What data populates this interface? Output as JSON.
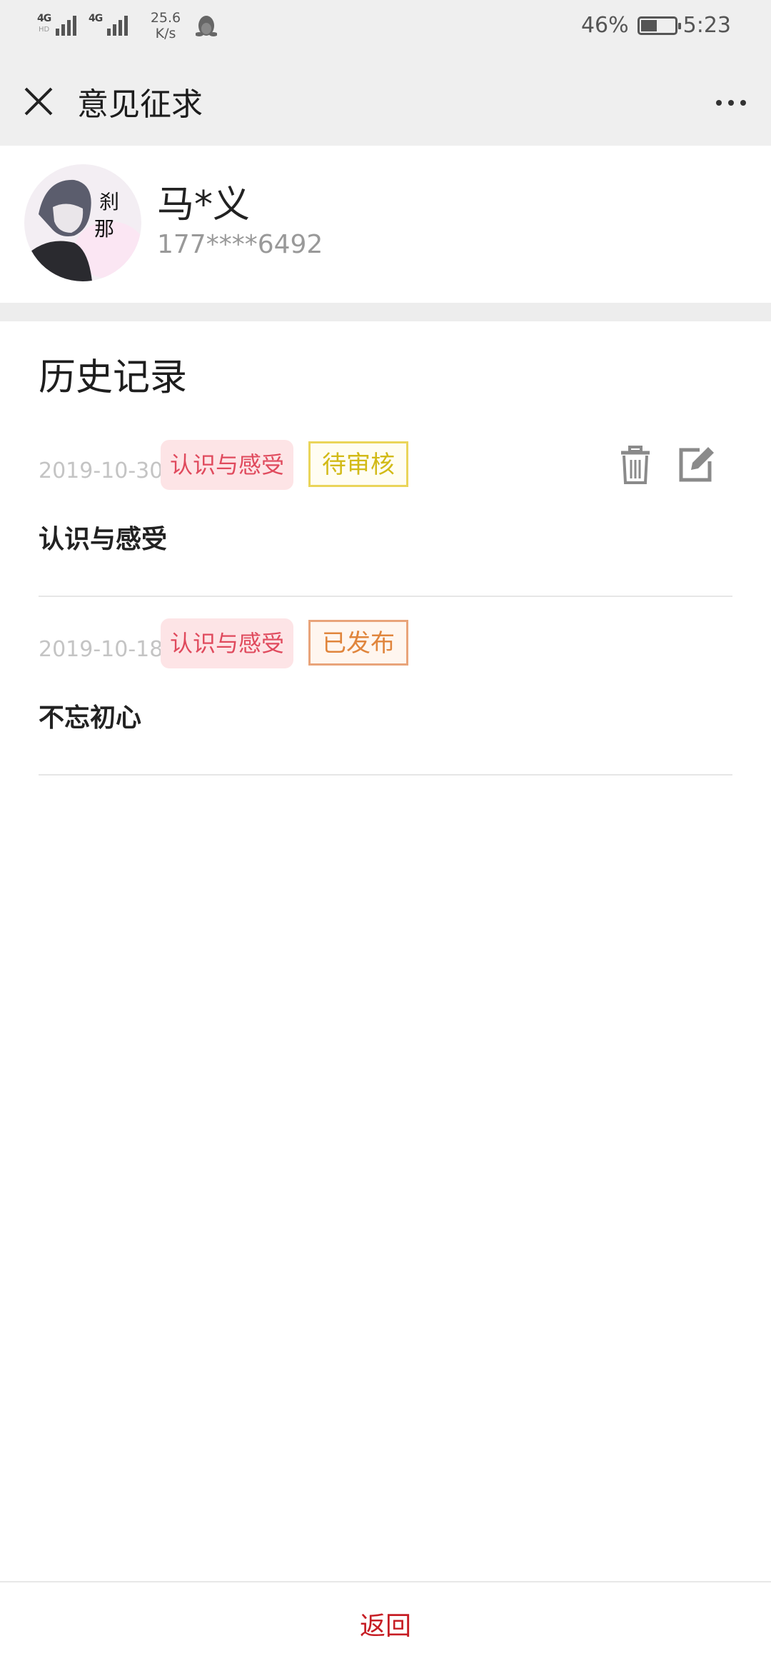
{
  "status_bar": {
    "net1": "4G",
    "net1_sub": "HD",
    "net2": "4G",
    "speed_value": "25.6",
    "speed_unit": "K/s",
    "battery_percent": "46%",
    "battery_level": 0.46,
    "time": "5:23"
  },
  "titlebar": {
    "title": "意见征求"
  },
  "profile": {
    "name": "马*义",
    "phone": "177****6492",
    "avatar_text": "刹那"
  },
  "history": {
    "title": "历史记录",
    "records": [
      {
        "date": "2019-10-30",
        "category": "认识与感受",
        "status": "待审核",
        "text": "认识与感受"
      },
      {
        "date": "2019-10-18",
        "category": "认识与感受",
        "status": "已发布",
        "text": "不忘初心"
      }
    ]
  },
  "footer": {
    "back_label": "返回"
  },
  "colors": {
    "accent_red": "#c61d24",
    "tag_pink_bg": "#fde4e6",
    "tag_pink_text": "#e04a5d",
    "pending_yellow": "#d2ba17",
    "published_orange": "#e0853c"
  }
}
